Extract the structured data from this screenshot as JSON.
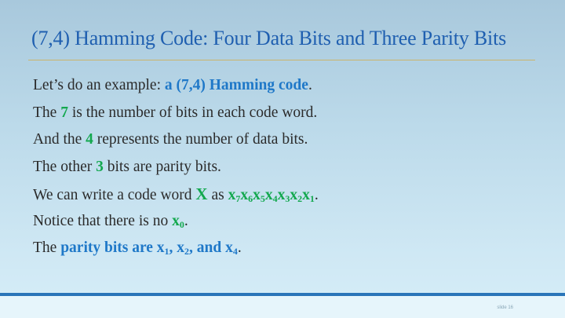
{
  "slide": {
    "title": "(7,4) Hamming Code: Four Data Bits and Three Parity Bits",
    "lines": [
      {
        "a": "Let’s do an example: ",
        "b": "a (7,4) Hamming code",
        "c": "."
      },
      {
        "a": "The ",
        "b": "7",
        "c": " is the number of bits in each code word."
      },
      {
        "a": "And the ",
        "b": "4",
        "c": " represents the number of data bits."
      },
      {
        "a": "The other ",
        "b": "3",
        "c": " bits are parity bits."
      },
      {
        "a": "We can write a code word ",
        "b": "X",
        "c": " as ",
        "subs": [
          "7",
          "6",
          "5",
          "4",
          "3",
          "2",
          "1"
        ],
        "x": "x",
        "d": "."
      },
      {
        "a": "Notice that there is no ",
        "x": "x",
        "sub": "0",
        "d": "."
      },
      {
        "a": "The ",
        "b": "parity bits are x",
        "s1": "1",
        "c": ", x",
        "s2": "2",
        "e": ", and x",
        "s4": "4",
        "d": "."
      }
    ],
    "footer": "slide 16"
  }
}
